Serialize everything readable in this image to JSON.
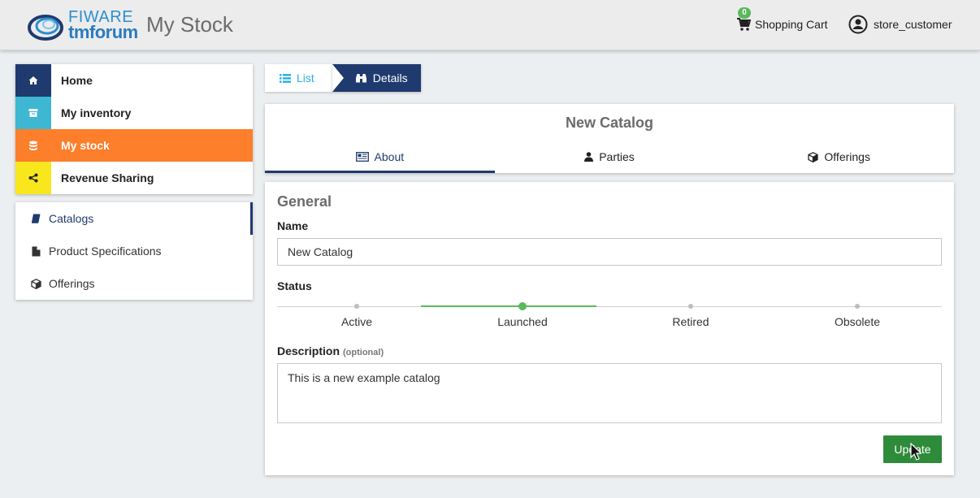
{
  "header": {
    "logo_top": "FIWARE",
    "logo_bottom": "tmforum",
    "title": "My Stock",
    "cart": {
      "label": "Shopping Cart",
      "count": "0",
      "icon": "shopping-cart-icon"
    },
    "user": {
      "name": "store_customer",
      "icon": "user-circle-icon"
    }
  },
  "sidebar": {
    "main": [
      {
        "label": "Home",
        "icon": "home-icon",
        "color": "#1f3a6e"
      },
      {
        "label": "My inventory",
        "icon": "archive-icon",
        "color": "#3db7d2"
      },
      {
        "label": "My stock",
        "icon": "database-icon",
        "color": "#fd7e2b",
        "active": true
      },
      {
        "label": "Revenue Sharing",
        "icon": "share-icon",
        "color": "#f8e71c"
      }
    ],
    "sub": [
      {
        "label": "Catalogs",
        "icon": "book-icon",
        "active": true
      },
      {
        "label": "Product Specifications",
        "icon": "file-icon"
      },
      {
        "label": "Offerings",
        "icon": "cube-icon"
      }
    ]
  },
  "breadcrumb": {
    "list": "List",
    "details": "Details"
  },
  "catalog": {
    "title": "New Catalog",
    "tabs": [
      {
        "label": "About",
        "icon": "newspaper-icon",
        "active": true
      },
      {
        "label": "Parties",
        "icon": "user-icon"
      },
      {
        "label": "Offerings",
        "icon": "cube-icon"
      }
    ]
  },
  "form": {
    "section": "General",
    "name_label": "Name",
    "name_value": "New Catalog",
    "status_label": "Status",
    "statuses": [
      "Active",
      "Launched",
      "Retired",
      "Obsolete"
    ],
    "status_selected": "Launched",
    "description_label": "Description",
    "description_optional": "(optional)",
    "description_value": "This is a new example catalog",
    "update_button": "Update"
  },
  "colors": {
    "navy": "#1f3a6e",
    "orange": "#fd7e2b",
    "green": "#2e8b3a",
    "cyan": "#2ab0e6"
  }
}
